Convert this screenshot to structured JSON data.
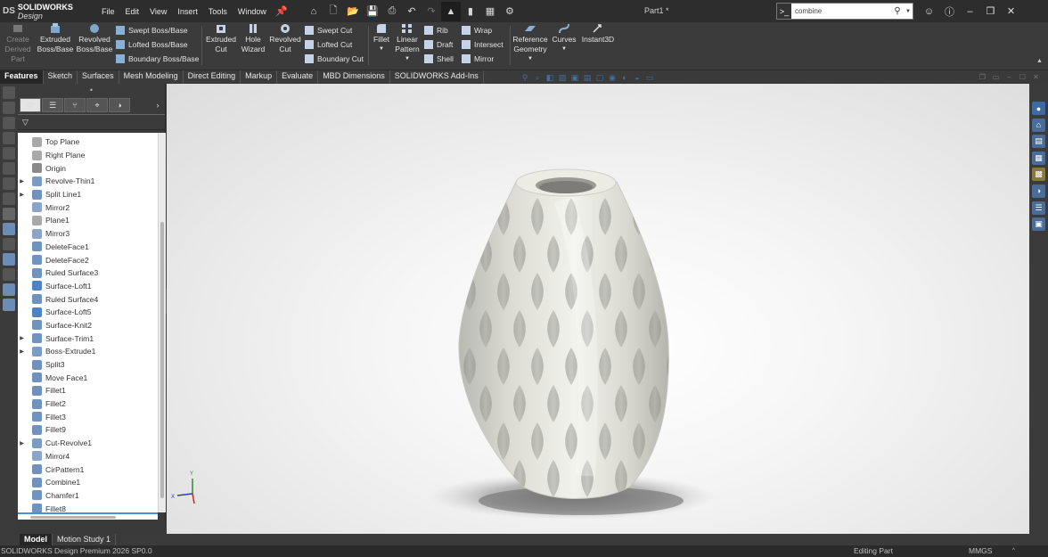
{
  "app": {
    "brand_mark": "DS",
    "brand_name": "SOLIDWORKS",
    "brand_edition": "Design",
    "document_title": "Part1 *"
  },
  "menu": [
    "File",
    "Edit",
    "View",
    "Insert",
    "Tools",
    "Window"
  ],
  "search": {
    "value": "combine",
    "command_glyph": ">_"
  },
  "command_manager": {
    "create_derived": "Create Derived Part",
    "extruded_boss": "Extruded Boss/Base",
    "revolved_boss": "Revolved Boss/Base",
    "swept_boss": "Swept Boss/Base",
    "lofted_boss": "Lofted Boss/Base",
    "boundary_boss": "Boundary Boss/Base",
    "extruded_cut": "Extruded Cut",
    "hole_wizard": "Hole Wizard",
    "revolved_cut": "Revolved Cut",
    "swept_cut": "Swept Cut",
    "lofted_cut": "Lofted Cut",
    "boundary_cut": "Boundary Cut",
    "fillet": "Fillet",
    "linear_pattern": "Linear Pattern",
    "rib": "Rib",
    "draft": "Draft",
    "shell": "Shell",
    "wrap": "Wrap",
    "intersect": "Intersect",
    "mirror": "Mirror",
    "reference_geometry": "Reference Geometry",
    "curves": "Curves",
    "instant3d": "Instant3D"
  },
  "tabs": [
    "Features",
    "Sketch",
    "Surfaces",
    "Mesh Modeling",
    "Direct Editing",
    "Markup",
    "Evaluate",
    "MBD Dimensions",
    "SOLIDWORKS Add-Ins"
  ],
  "feature_tree": [
    {
      "label": "Top Plane",
      "expand": false,
      "color": "#a9a9a9"
    },
    {
      "label": "Right Plane",
      "expand": false,
      "color": "#a9a9a9"
    },
    {
      "label": "Origin",
      "expand": false,
      "color": "#8a8a8a"
    },
    {
      "label": "Revolve-Thin1",
      "expand": true,
      "color": "#7a9cc0"
    },
    {
      "label": "Split Line1",
      "expand": true,
      "color": "#6f93bd"
    },
    {
      "label": "Mirror2",
      "expand": false,
      "color": "#8aa5c8"
    },
    {
      "label": "Plane1",
      "expand": false,
      "color": "#a9a9a9"
    },
    {
      "label": "Mirror3",
      "expand": false,
      "color": "#8aa5c8"
    },
    {
      "label": "DeleteFace1",
      "expand": false,
      "color": "#6f93bd"
    },
    {
      "label": "DeleteFace2",
      "expand": false,
      "color": "#6f93bd"
    },
    {
      "label": "Ruled Surface3",
      "expand": false,
      "color": "#6f93bd"
    },
    {
      "label": "Surface-Loft1",
      "expand": false,
      "color": "#4f84c4"
    },
    {
      "label": "Ruled Surface4",
      "expand": false,
      "color": "#6f93bd"
    },
    {
      "label": "Surface-Loft5",
      "expand": false,
      "color": "#4f84c4"
    },
    {
      "label": "Surface-Knit2",
      "expand": false,
      "color": "#6f93bd"
    },
    {
      "label": "Surface-Trim1",
      "expand": true,
      "color": "#6f93bd"
    },
    {
      "label": "Boss-Extrude1",
      "expand": true,
      "color": "#7a9cc0"
    },
    {
      "label": "Split3",
      "expand": false,
      "color": "#6f93bd"
    },
    {
      "label": "Move Face1",
      "expand": false,
      "color": "#6f93bd"
    },
    {
      "label": "Fillet1",
      "expand": false,
      "color": "#6f93bd"
    },
    {
      "label": "Fillet2",
      "expand": false,
      "color": "#6f93bd"
    },
    {
      "label": "Fillet3",
      "expand": false,
      "color": "#6f93bd"
    },
    {
      "label": "Fillet9",
      "expand": false,
      "color": "#6f93bd"
    },
    {
      "label": "Cut-Revolve1",
      "expand": true,
      "color": "#7a9cc0"
    },
    {
      "label": "Mirror4",
      "expand": false,
      "color": "#8aa5c8"
    },
    {
      "label": "CirPattern1",
      "expand": false,
      "color": "#6f93bd"
    },
    {
      "label": "Combine1",
      "expand": false,
      "color": "#6f93bd"
    },
    {
      "label": "Chamfer1",
      "expand": false,
      "color": "#6f93bd"
    },
    {
      "label": "Fillet8",
      "expand": false,
      "color": "#6f93bd"
    }
  ],
  "bottom_tabs": [
    "Model",
    "Motion Study 1"
  ],
  "status": {
    "product": "SOLIDWORKS Design Premium 2026 SP0.0",
    "mode": "Editing Part",
    "units": "MMGS",
    "arrow": "^"
  },
  "axes": {
    "y": "Y",
    "x": "X"
  },
  "colors": {
    "chrome": "#3b3b3b",
    "accent": "#4d8fd1",
    "model_surface": "#efefe8",
    "taskpane_icon": "#4a6d97"
  }
}
